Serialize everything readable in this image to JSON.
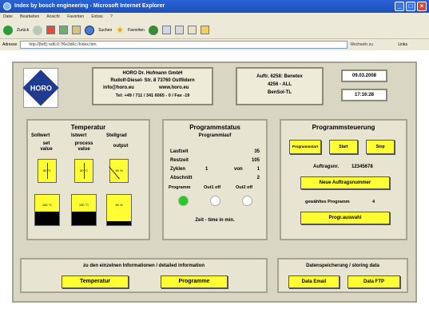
{
  "window": {
    "title": "Index by bosch engineering - Microsoft Internet Explorer",
    "controls": [
      "_",
      "□",
      "×"
    ]
  },
  "menu": [
    "Datei",
    "Bearbeiten",
    "Ansicht",
    "Favoriten",
    "Extras",
    "?"
  ],
  "toolbar": {
    "back": "Zurück",
    "search": "Suchen",
    "favorites": "Favoriten"
  },
  "address": {
    "label": "Adresse",
    "url": "http://[fe8]::ed6:0:7f6e3d6c:/Index.htm",
    "go": "Wechseln zu",
    "links": "Links"
  },
  "company": {
    "logo_text": "HORO",
    "line1": "HORO Dr. Hofmann GmbH",
    "line2": "Rudolf-Diesel- Str. 8 73760 Ostfildern",
    "email": "info@horo.eu",
    "web": "www.horo.eu",
    "phone": "Tel: +49 / 711 / 341 6065 - 0 / Fax -19"
  },
  "order": {
    "line1": "Auftr. 6258: Benetex",
    "line2": "4256 - ALL",
    "line3": "BenSol-TL"
  },
  "datetime": {
    "date": "09.03.2008",
    "time": "17:16:28"
  },
  "temperatur": {
    "title": "Temperatur",
    "col1": "Sollwert",
    "col2": "Istwert",
    "col3": "Stellgrad",
    "sub1a": "set",
    "sub1b": "value",
    "sub2a": "process",
    "sub2b": "value",
    "sub3": "output",
    "gauge1": "50 °C",
    "gauge2": "50 °C",
    "gauge3": "50 %",
    "bar1": "150 °C",
    "bar2": "150 °C",
    "bar3": "50 %"
  },
  "status": {
    "title": "Programmstatus",
    "subtitle": "Programmlauf",
    "laufzeit_label": "Laufzeit",
    "laufzeit_value": "35",
    "restzeit_label": "Restzeit",
    "restzeit_value": "105",
    "zyklen_label": "Zyklen",
    "zyklen_value": "1",
    "zyklen_von": "von",
    "zyklen_total": "1",
    "abschnitt_label": "Abschnitt",
    "abschnitt_value": "2",
    "lamp1_label": "Programm",
    "lamp2_label": "Out1 off",
    "lamp3_label": "Out2 off",
    "footer": "Zeit - time in min."
  },
  "steuerung": {
    "title": "Programmsteuerung",
    "btn_program": "Programmstart",
    "btn_start": "Start",
    "btn_stop": "Stop",
    "order_label": "Auftragsnr.",
    "order_value": "12345678",
    "btn_new_order": "Neue Auftragsnummer",
    "selected_label": "gewähltes Programm",
    "selected_value": "4",
    "btn_select": "Progr.auswahl"
  },
  "bottom_left": {
    "caption": "zu den einzelnen Informationen / detailed information",
    "btn_temp": "Temperatur",
    "btn_prog": "Programme"
  },
  "bottom_right": {
    "caption": "Datenspeicherung / storing data",
    "btn_email": "Data Email",
    "btn_ftp": "Data FTP"
  },
  "colors": {
    "yellow": "#ffff33",
    "lamp_on": "#22cc22",
    "lamp_off": "#ffffff",
    "titlebar": "#1d4fb8"
  },
  "levels": {
    "bar1_fill_percent": 45,
    "bar2_fill_percent": 45,
    "bar3_fill_percent": 12
  },
  "icons": [
    "internet-explorer-icon",
    "back-arrow-icon",
    "forward-arrow-icon",
    "stop-icon",
    "refresh-icon",
    "home-icon",
    "search-icon",
    "favorites-star-icon",
    "history-icon",
    "mail-icon",
    "print-icon",
    "edit-icon",
    "folder-icon"
  ]
}
